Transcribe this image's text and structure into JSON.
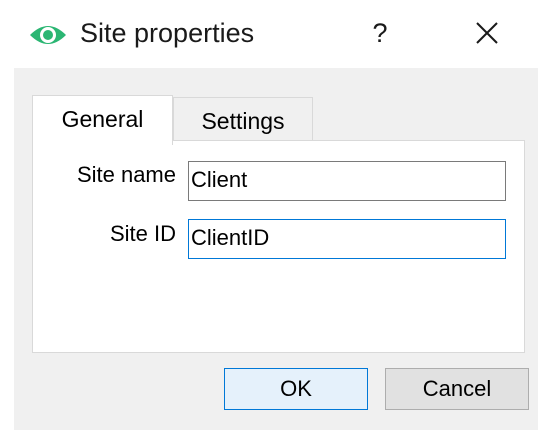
{
  "window": {
    "title": "Site properties",
    "help_label": "?",
    "icon": "eye-icon",
    "close_icon": "close-icon",
    "accent_color": "#2bb673"
  },
  "tabs": [
    {
      "label": "General",
      "selected": true
    },
    {
      "label": "Settings",
      "selected": false
    }
  ],
  "form": {
    "site_name": {
      "label": "Site name",
      "value": "Client"
    },
    "site_id": {
      "label": "Site ID",
      "value": "ClientID",
      "focused": true
    }
  },
  "buttons": {
    "ok_label": "OK",
    "cancel_label": "Cancel"
  }
}
